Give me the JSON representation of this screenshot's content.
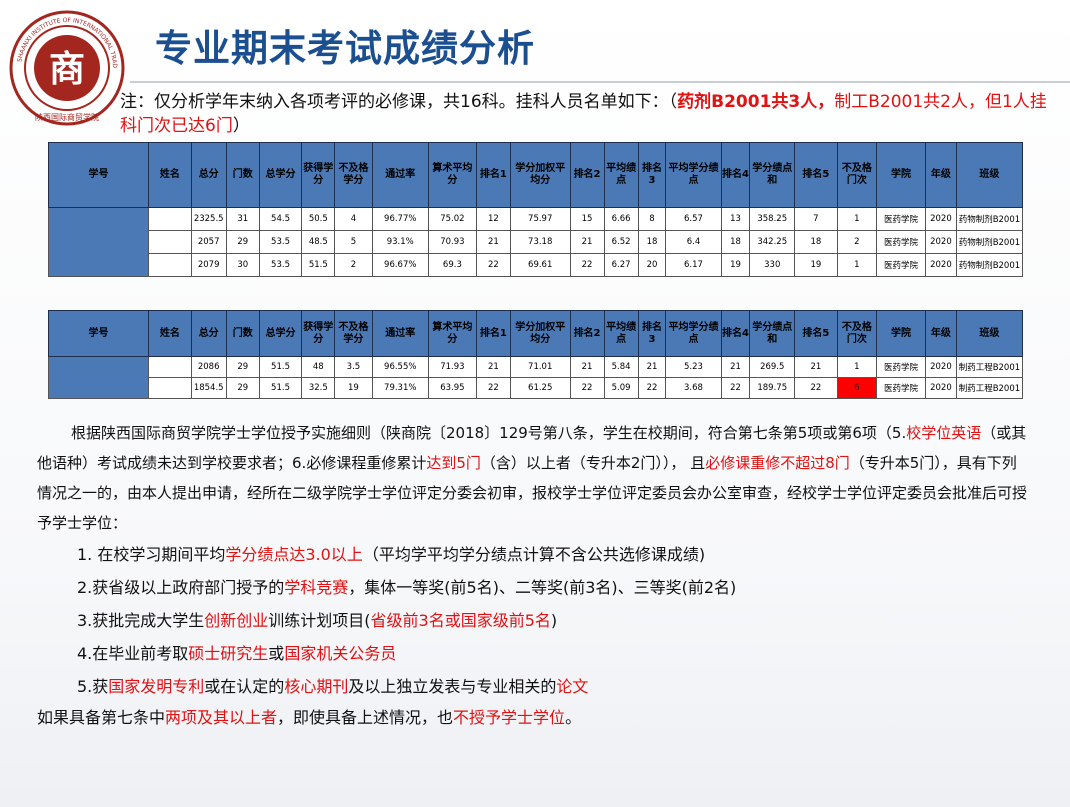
{
  "title": "专业期末考试成绩分析",
  "logo": {
    "seal_char": "商",
    "ring_text": "SHAANXI INSTITUTE OF INTERNATIONAL TRADE & COMMERCE",
    "bottom_text": "陕西国际商贸学院"
  },
  "note": {
    "prefix": "注：仅分析学年末纳入各项考评的必修课，共16科。挂科人员名单如下：（",
    "highlight1": "药剂B2001共3人，",
    "mid": "制工B2001共2人，但1人挂科门次已达6门",
    "suffix": "）"
  },
  "table1": {
    "headers": [
      "学号",
      "姓名",
      "总分",
      "门数",
      "总学分",
      "获得学分",
      "不及格学分",
      "通过率",
      "算术平均分",
      "排名1",
      "学分加权平均分",
      "排名2",
      "平均绩点",
      "排名3",
      "平均学分绩点",
      "排名4",
      "学分绩点和",
      "排名5",
      "不及格门次",
      "学院",
      "年级",
      "班级"
    ],
    "rows": [
      [
        "",
        "",
        "2325.5",
        "31",
        "54.5",
        "50.5",
        "4",
        "96.77%",
        "75.02",
        "12",
        "75.97",
        "15",
        "6.66",
        "8",
        "6.57",
        "13",
        "358.25",
        "7",
        "1",
        "医药学院",
        "2020",
        "药物制剂B2001"
      ],
      [
        "",
        "",
        "2057",
        "29",
        "53.5",
        "48.5",
        "5",
        "93.1%",
        "70.93",
        "21",
        "73.18",
        "21",
        "6.52",
        "18",
        "6.4",
        "18",
        "342.25",
        "18",
        "2",
        "医药学院",
        "2020",
        "药物制剂B2001"
      ],
      [
        "",
        "",
        "2079",
        "30",
        "53.5",
        "51.5",
        "2",
        "96.67%",
        "69.3",
        "22",
        "69.61",
        "22",
        "6.27",
        "20",
        "6.17",
        "19",
        "330",
        "19",
        "1",
        "医药学院",
        "2020",
        "药物制剂B2001"
      ]
    ]
  },
  "table2": {
    "headers": [
      "学号",
      "姓名",
      "总分",
      "门数",
      "总学分",
      "获得学分",
      "不及格学分",
      "通过率",
      "算术平均分",
      "排名1",
      "学分加权平均分",
      "排名2",
      "平均绩点",
      "排名3",
      "平均学分绩点",
      "排名4",
      "学分绩点和",
      "排名5",
      "不及格门次",
      "学院",
      "年级",
      "班级"
    ],
    "rows": [
      [
        "",
        "",
        "2086",
        "29",
        "51.5",
        "48",
        "3.5",
        "96.55%",
        "71.93",
        "21",
        "71.01",
        "21",
        "5.84",
        "21",
        "5.23",
        "21",
        "269.5",
        "21",
        "1",
        "医药学院",
        "2020",
        "制药工程B2001"
      ],
      [
        "",
        "",
        "1854.5",
        "29",
        "51.5",
        "32.5",
        "19",
        "79.31%",
        "63.95",
        "22",
        "61.25",
        "22",
        "5.09",
        "22",
        "3.68",
        "22",
        "189.75",
        "22",
        "6",
        "医药学院",
        "2020",
        "制药工程B2001"
      ]
    ]
  },
  "rules": {
    "p1_a": "根据陕西国际商贸学院学士学位授予实施细则（陕商院〔2018〕129号第八条，学生在校期间，符合第七条第5项或第6项（5.",
    "p1_b": "校学位英语",
    "p1_c": "（或其他语种）考试成绩未达到学校要求者；6.必修课程重修累计",
    "p1_d": "达到5门",
    "p1_e": "（含）以上者（专升本2门））， 且",
    "p1_f": "必修课重修不超过8门",
    "p1_g": "（专升本5门），具有下列情况之一的，由本人提出申请，经所在二级学院学士学位评定分委会初审，报校学士学位评定委员会办公室审查，经校学士学位评定委员会批准后可授予学士学位：",
    "i1_a": "1. 在校学习期间平均",
    "i1_b": "学分绩点达3.0以上",
    "i1_c": "（平均学平均学分绩点计算不含公共选修课成绩)",
    "i2_a": "2.获省级以上政府部门授予的",
    "i2_b": "学科竞赛",
    "i2_c": "，集体一等奖(前5名)、二等奖(前3名)、三等奖(前2名)",
    "i3_a": "3.获批完成大学生",
    "i3_b": "创新创业",
    "i3_c": "训练计划项目(",
    "i3_d": "省级前3名或国家级前5名",
    "i3_e": ")",
    "i4_a": "4.在毕业前考取",
    "i4_b": "硕士研究生",
    "i4_c": "或",
    "i4_d": "国家机关公务员",
    "i5_a": "5.获",
    "i5_b": "国家发明专利",
    "i5_c": "或在认定的",
    "i5_d": "核心期刊",
    "i5_e": "及以上独立发表与专业相关的",
    "i5_f": "论文",
    "last_a": "如果具备第七条中",
    "last_b": "两项及其以上者",
    "last_c": "，即使具备上述情况，也",
    "last_d": "不授予学士学位",
    "last_e": "。"
  },
  "colors": {
    "title": "#1b4f8f",
    "header_fill": "#4a79b5",
    "highlight": "#e01212",
    "fail_cell": "#ff0000",
    "seal": "#a3261f"
  }
}
